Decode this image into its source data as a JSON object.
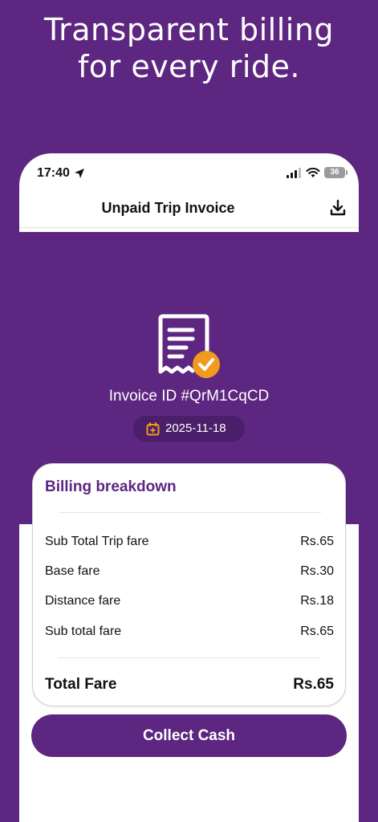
{
  "headline": {
    "line1": "Transparent billing",
    "line2": "for every ride."
  },
  "status_bar": {
    "time": "17:40",
    "battery": "36",
    "icons": [
      "location-arrow-icon",
      "signal-icon",
      "wifi-icon",
      "battery-icon"
    ]
  },
  "nav": {
    "title": "Unpaid Trip Invoice",
    "download_icon": "download-icon"
  },
  "invoice": {
    "icon": "receipt-check-icon",
    "id_text": "Invoice ID #QrM1CqCD",
    "date": "2025-11-18",
    "date_icon": "calendar-icon"
  },
  "billing": {
    "title": "Billing breakdown",
    "rows": [
      {
        "label": "Sub Total Trip fare",
        "value": "Rs.65"
      },
      {
        "label": "Base fare",
        "value": "Rs.30"
      },
      {
        "label": "Distance fare",
        "value": "Rs.18"
      },
      {
        "label": "Sub total fare",
        "value": "Rs.65"
      }
    ],
    "total_label": "Total Fare",
    "total_value": "Rs.65"
  },
  "action": {
    "collect_label": "Collect Cash"
  },
  "colors": {
    "brand_purple": "#5d2680",
    "accent_orange": "#f29a1f",
    "pill_bg": "#4a1e68"
  }
}
